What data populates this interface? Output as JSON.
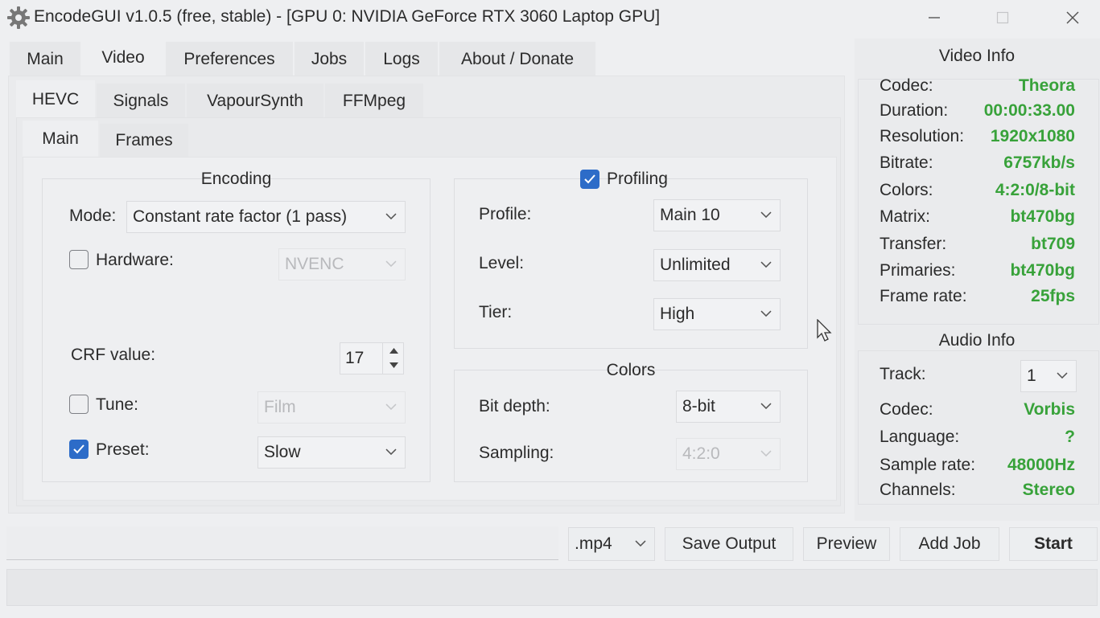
{
  "window": {
    "title": "EncodeGUI v1.0.5 (free, stable) - [GPU 0: NVIDIA GeForce RTX 3060 Laptop GPU]"
  },
  "main_tabs": [
    "Main",
    "Video",
    "Preferences",
    "Jobs",
    "Logs",
    "About / Donate"
  ],
  "codec_tabs": [
    "HEVC",
    "Signals",
    "VapourSynth",
    "FFMpeg"
  ],
  "sub_tabs": [
    "Main",
    "Frames"
  ],
  "encoding": {
    "title": "Encoding",
    "mode_label": "Mode:",
    "mode_value": "Constant rate factor (1 pass)",
    "hardware_label": "Hardware:",
    "hardware_checked": false,
    "hardware_value": "NVENC",
    "crf_label": "CRF value:",
    "crf_value": "17",
    "tune_label": "Tune:",
    "tune_checked": false,
    "tune_value": "Film",
    "preset_label": "Preset:",
    "preset_checked": true,
    "preset_value": "Slow"
  },
  "profiling": {
    "title": "Profiling",
    "checked": true,
    "profile_label": "Profile:",
    "profile_value": "Main 10",
    "level_label": "Level:",
    "level_value": "Unlimited",
    "tier_label": "Tier:",
    "tier_value": "High"
  },
  "colors": {
    "title": "Colors",
    "bit_depth_label": "Bit depth:",
    "bit_depth_value": "8-bit",
    "sampling_label": "Sampling:",
    "sampling_value": "4:2:0"
  },
  "video_info": {
    "title": "Video Info",
    "rows": [
      {
        "label": "Codec:",
        "value": "Theora"
      },
      {
        "label": "Duration:",
        "value": "00:00:33.00"
      },
      {
        "label": "Resolution:",
        "value": "1920x1080"
      },
      {
        "label": "Bitrate:",
        "value": "6757kb/s"
      },
      {
        "label": "Colors:",
        "value": "4:2:0/8-bit"
      },
      {
        "label": "Matrix:",
        "value": "bt470bg"
      },
      {
        "label": "Transfer:",
        "value": "bt709"
      },
      {
        "label": "Primaries:",
        "value": "bt470bg"
      },
      {
        "label": "Frame rate:",
        "value": "25fps"
      }
    ]
  },
  "audio_info": {
    "title": "Audio Info",
    "track_label": "Track:",
    "track_value": "1",
    "rows": [
      {
        "label": "Codec:",
        "value": "Vorbis"
      },
      {
        "label": "Language:",
        "value": "?"
      },
      {
        "label": "Sample rate:",
        "value": "48000Hz"
      },
      {
        "label": "Channels:",
        "value": "Stereo"
      }
    ]
  },
  "bottom": {
    "output_path": "",
    "extension": ".mp4",
    "save_output": "Save Output",
    "preview": "Preview",
    "add_job": "Add Job",
    "start": "Start"
  },
  "status_bar": "",
  "colors_theme": {
    "info_value": "#38a23a",
    "checkbox_accent": "#2d6cc8",
    "background": "#eeeff1"
  }
}
